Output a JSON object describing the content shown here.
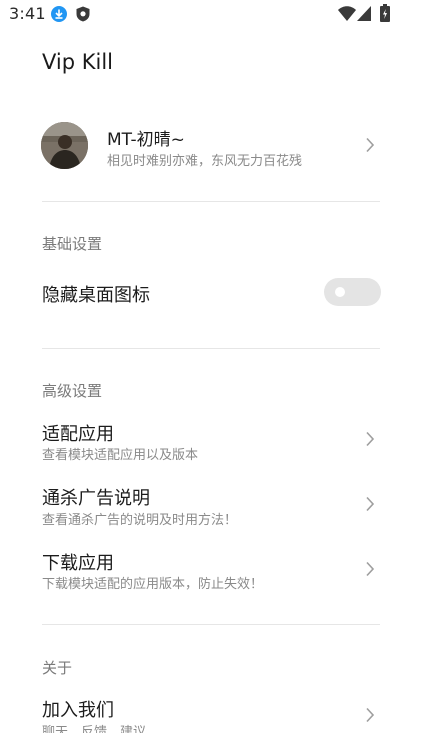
{
  "status_bar": {
    "time": "3:41",
    "icons": [
      "download-icon",
      "shield-icon",
      "wifi-icon",
      "signal-icon",
      "battery-icon"
    ]
  },
  "app": {
    "title": "Vip Kill"
  },
  "profile": {
    "name": "MT-初晴~",
    "subtitle": "相见时难别亦难，东风无力百花残"
  },
  "sections": {
    "basic": {
      "title": "基础设置",
      "hide_icon_label": "隐藏桌面图标",
      "hide_icon_enabled": false
    },
    "advanced": {
      "title": "高级设置",
      "items": [
        {
          "title": "适配应用",
          "subtitle": "查看模块适配应用以及版本"
        },
        {
          "title": "通杀广告说明",
          "subtitle": "查看通杀广告的说明及时用方法！"
        },
        {
          "title": "下载应用",
          "subtitle": "下载模块适配的应用版本，防止失效！"
        }
      ]
    },
    "about": {
      "title": "关于",
      "items": [
        {
          "title": "加入我们",
          "subtitle": "聊天、反馈、建议"
        }
      ]
    }
  },
  "colors": {
    "accent_download": "#2196f3",
    "toggle_off": "#e4e4e4",
    "divider": "#e6e6e6"
  }
}
